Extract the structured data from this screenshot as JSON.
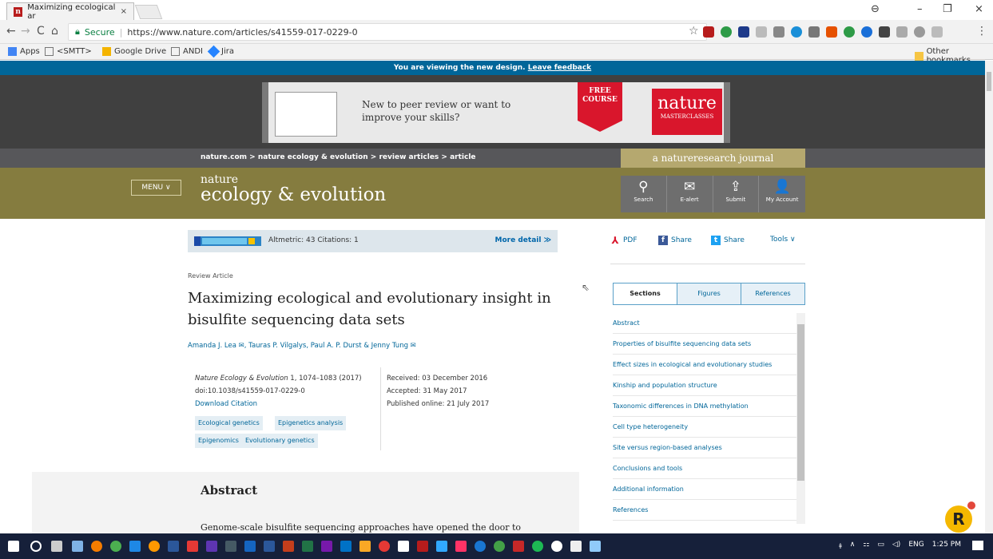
{
  "browser": {
    "tab_title": "Maximizing ecological ar",
    "tab_close": "×",
    "favicon_letter": "n",
    "url_secure": "Secure",
    "url": "https://www.nature.com/articles/s41559-017-0229-0",
    "min": "–",
    "restore": "❐",
    "close": "×",
    "back": "←",
    "forward": "→",
    "reload": "C",
    "home": "⌂",
    "star": "☆",
    "menu": "⋮"
  },
  "bookmarks": {
    "apps": "Apps",
    "smtt": "<SMTT>",
    "gdrive": "Google Drive",
    "andi": "ANDI",
    "jira": "Jira",
    "other": "Other bookmarks"
  },
  "site": {
    "new_design_text": "You are viewing the new design.",
    "leave_feedback": "Leave feedback",
    "ad_text": "New to peer review or want to improve your skills?",
    "ad_free": "FREE COURSE",
    "ad_brand_1": "nature",
    "ad_brand_2": "MASTERCLASSES",
    "breadcrumb": "nature.com  >  nature ecology & evolution  >  review articles  >  article",
    "naturereseach_journal": "a natureresearch journal",
    "menu": "MENU ∨",
    "logo_1": "nature",
    "logo_2": "ecology & evolution",
    "icons": [
      {
        "label": "Search",
        "glyph": "⚲"
      },
      {
        "label": "E-alert",
        "glyph": "✉"
      },
      {
        "label": "Submit",
        "glyph": "⇪"
      },
      {
        "label": "My Account",
        "glyph": "👤"
      }
    ]
  },
  "metrics": {
    "text": "Altmetric: 43     Citations: 1",
    "more": "More detail ≫"
  },
  "share": {
    "pdf": "PDF",
    "fb": "Share",
    "tw": "Share",
    "tools": "Tools ∨"
  },
  "article": {
    "type": "Review Article",
    "title": "Maximizing ecological and evolutionary insight in bisulfite sequencing data sets",
    "authors": "Amanda J. Lea ✉, Tauras P. Vilgalys, Paul A. P. Durst & Jenny Tung ✉",
    "journal": "Nature Ecology & Evolution",
    "volume": " 1, 1074–1083 (2017)",
    "doi": "doi:10.1038/s41559-017-0229-0",
    "download": "Download Citation",
    "received": "Received:  03 December 2016",
    "accepted": "Accepted:  31 May 2017",
    "published": "Published online:  21 July 2017",
    "tags": [
      "Ecological genetics",
      "Epigenetics analysis",
      "Epigenomics",
      "Evolutionary genetics"
    ],
    "abstract_heading": "Abstract",
    "abstract_text": "Genome-scale bisulfite sequencing approaches have opened the door to"
  },
  "sections": {
    "tabs": [
      "Sections",
      "Figures",
      "References"
    ],
    "items": [
      "Abstract",
      "Properties of bisulfite sequencing data sets",
      "Effect sizes in ecological and evolutionary studies",
      "Kinship and population structure",
      "Taxonomic differences in DNA methylation",
      "Cell type heterogeneity",
      "Site versus region-based analyses",
      "Conclusions and tools",
      "Additional information",
      "References"
    ]
  },
  "taskbar": {
    "lang": "ENG",
    "time": "1:25 PM"
  },
  "colors": {
    "accent": "#006699",
    "masthead": "#857c3f",
    "brand_red": "#d9162c"
  }
}
